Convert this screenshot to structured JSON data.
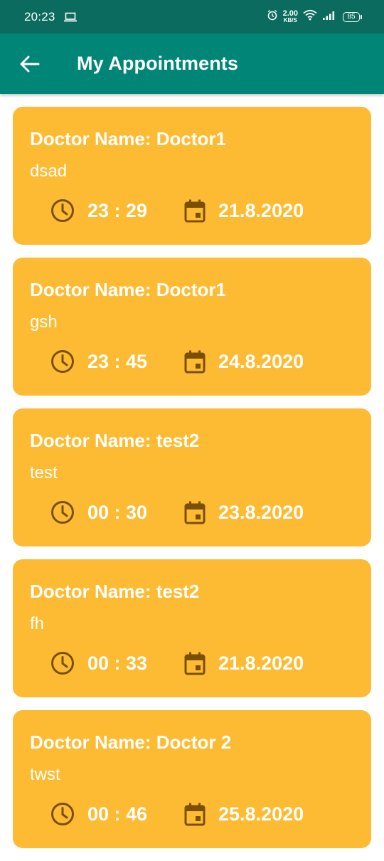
{
  "status_bar": {
    "time": "20:23",
    "net_speed_value": "2.00",
    "net_speed_unit": "KB/S",
    "battery": "85"
  },
  "app_bar": {
    "title": "My Appointments",
    "back_icon": "arrow-left-icon"
  },
  "colors": {
    "app_bar": "#008577",
    "status_bar": "#0b6b5f",
    "card": "#fdbb33",
    "icon": "#7a4f00"
  },
  "appointments": [
    {
      "doctor": "Doctor Name: Doctor1",
      "description": "dsad",
      "time": "23 : 29",
      "date": "21.8.2020"
    },
    {
      "doctor": "Doctor Name: Doctor1",
      "description": "gsh",
      "time": "23 : 45",
      "date": "24.8.2020"
    },
    {
      "doctor": "Doctor Name: test2",
      "description": "test",
      "time": "00 : 30",
      "date": "23.8.2020"
    },
    {
      "doctor": "Doctor Name: test2",
      "description": "fh",
      "time": "00 : 33",
      "date": "21.8.2020"
    },
    {
      "doctor": "Doctor Name: Doctor 2",
      "description": "twst",
      "time": "00 : 46",
      "date": "25.8.2020"
    }
  ]
}
